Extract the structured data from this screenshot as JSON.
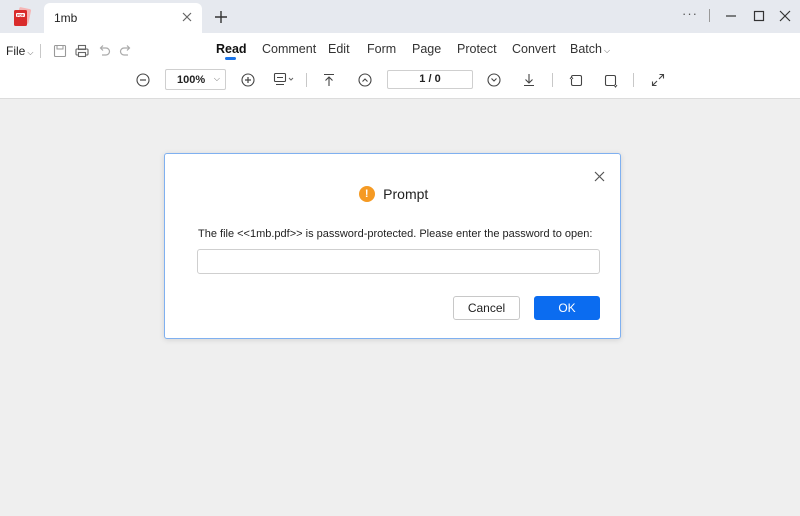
{
  "tab": {
    "title": "1mb"
  },
  "window": {
    "more_label": "···"
  },
  "menu": {
    "file_label": "File",
    "tabs": [
      "Read",
      "Comment",
      "Edit",
      "Form",
      "Page",
      "Protect",
      "Convert",
      "Batch"
    ],
    "active_tab": "Read"
  },
  "toolbar": {
    "zoom_value": "100%",
    "page_indicator": "1  / 0"
  },
  "dialog": {
    "title": "Prompt",
    "message": "The file <<1mb.pdf>> is password-protected. Please enter the password to open:",
    "password_value": "",
    "password_placeholder": "",
    "cancel_label": "Cancel",
    "ok_label": "OK"
  },
  "colors": {
    "accent": "#0b6cf0",
    "warning": "#f59a23",
    "tabbar_bg": "#e6e9ef",
    "workspace_bg": "#efefef"
  },
  "icons": [
    "app-logo",
    "close-icon",
    "plus-icon",
    "more-icon",
    "minimize-icon",
    "maximize-icon",
    "save-icon",
    "print-icon",
    "undo-icon",
    "redo-icon",
    "zoom-out-icon",
    "zoom-in-icon",
    "stamp-icon",
    "first-page-icon",
    "prev-page-icon",
    "next-page-icon",
    "last-page-icon",
    "rotate-left-icon",
    "rotate-right-icon",
    "fullscreen-icon",
    "warning-icon"
  ]
}
